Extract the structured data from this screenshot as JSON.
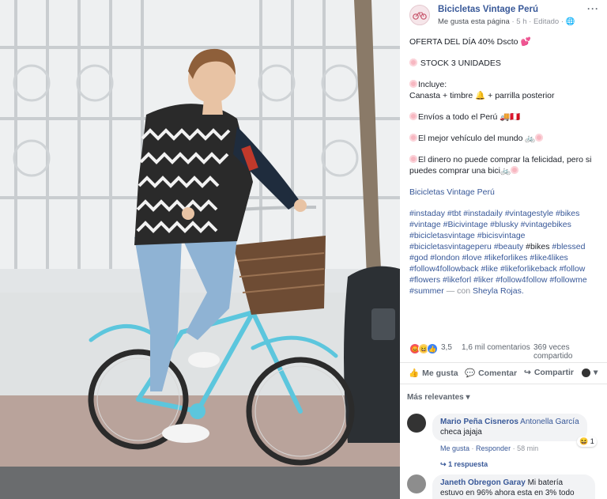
{
  "post": {
    "page_name": "Bicicletas Vintage Perú",
    "meta_like": "Me gusta esta página",
    "meta_time": "5 h",
    "meta_edit": "Editado",
    "lines": {
      "offer": "OFERTA DEL DÍA 40% Dscto 💕",
      "stock": "STOCK 3 UNIDADES",
      "includes": "Incluye:",
      "includes_items": "Canasta + timbre 🔔 + parrilla posterior",
      "shipping": "Envíos a todo el Perú 🚚🇵🇪",
      "vehicle": "El mejor vehículo del mundo 🚲",
      "happiness": "El dinero no puede comprar la felicidad, pero si puedes comprar una bici🚲",
      "page_link": "Bicicletas Vintage Perú",
      "hashtags": "#instaday #tbt #instadaily #vintagestyle #bikes #vintage #Bicivintage #blusky #vintagebikes #bicicletasvintage #bicisvintage #bicicletasvintageperu #beauty",
      "plain_bikes": "#bikes",
      "hashtags2": "#blessed #god #london #love #likeforlikes #like4likes #follow4followback #like #likeforlikeback #follow #flowers #likeforl #liker #follow4follow #followme #summer",
      "with": "— con",
      "tagged": "Sheyla Rojas."
    }
  },
  "stats": {
    "reaction_count": "3,5",
    "comments": "1,6 mil comentarios",
    "shares": "369 veces compartido"
  },
  "actions": {
    "like": "Me gusta",
    "comment": "Comentar",
    "share": "Compartir"
  },
  "comments_filter": "Más relevantes",
  "comments": [
    {
      "author": "Mario Peña Cisneros",
      "tag": "Antonella García",
      "text": "checa jajaja",
      "like": "Me gusta",
      "reply": "Responder",
      "time": "58 min",
      "reactions": "1",
      "replies": "1 respuesta"
    },
    {
      "author": "Janeth Obregon Garay",
      "text": "Mi batería estuvo en 96% ahora esta en 3% todo consume"
    }
  ],
  "colors": {
    "link": "#385898",
    "panel_bg": "#ffffff",
    "bike": "#5cc6dd"
  }
}
